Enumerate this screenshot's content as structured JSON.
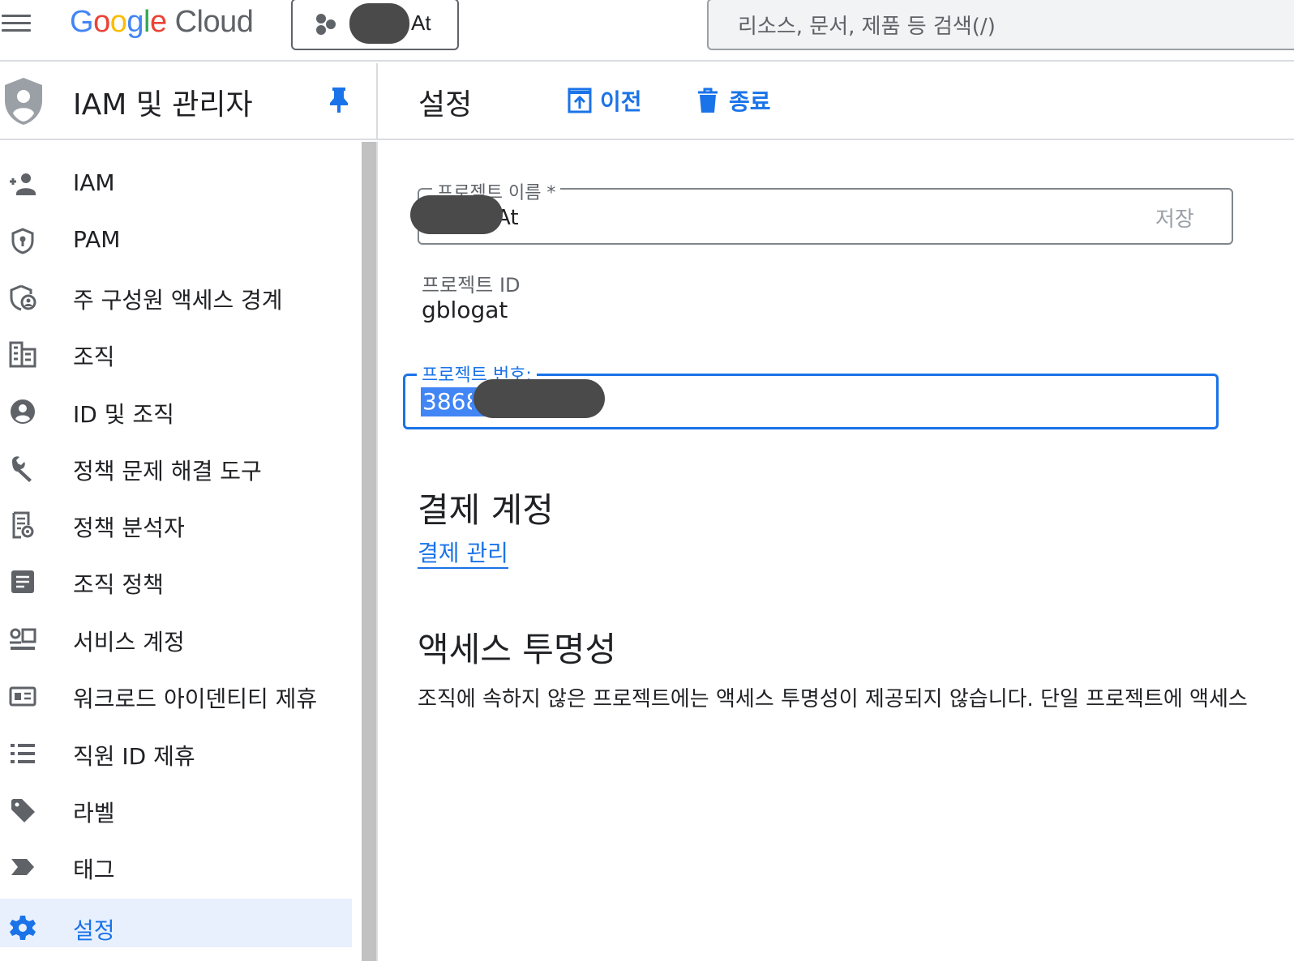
{
  "topbar": {
    "logo_google": "Google",
    "logo_cloud": "Cloud",
    "project_name": "At",
    "search_placeholder": "리소스, 문서, 제품 등 검색(/)"
  },
  "sidebar": {
    "title": "IAM 및 관리자",
    "items": [
      {
        "label": "IAM",
        "icon": "person-add-icon"
      },
      {
        "label": "PAM",
        "icon": "shield-lock-icon"
      },
      {
        "label": "주 구성원 액세스 경계",
        "icon": "shield-person-icon"
      },
      {
        "label": "조직",
        "icon": "building-icon"
      },
      {
        "label": "ID 및 조직",
        "icon": "account-circle-icon"
      },
      {
        "label": "정책 문제 해결 도구",
        "icon": "wrench-icon"
      },
      {
        "label": "정책 분석자",
        "icon": "policy-doc-icon"
      },
      {
        "label": "조직 정책",
        "icon": "article-icon"
      },
      {
        "label": "서비스 계정",
        "icon": "service-account-icon"
      },
      {
        "label": "워크로드 아이덴티티 제휴",
        "icon": "id-card-icon"
      },
      {
        "label": "직원 ID 제휴",
        "icon": "list-icon"
      },
      {
        "label": "라벨",
        "icon": "label-icon"
      },
      {
        "label": "태그",
        "icon": "tag-icon"
      },
      {
        "label": "설정",
        "icon": "gear-icon",
        "active": true
      }
    ]
  },
  "main": {
    "title": "설정",
    "migrate_label": "이전",
    "shutdown_label": "종료",
    "project_name_label": "프로젝트 이름 *",
    "project_name_value": "At",
    "save_label": "저장",
    "project_id_label": "프로젝트 ID",
    "project_id_value": "gblogat",
    "project_number_label": "프로젝트 번호:",
    "project_number_value": "3868",
    "billing_heading": "결제 계정",
    "billing_link": "결제 관리",
    "access_heading": "액세스 투명성",
    "access_text": "조직에 속하지 않은 프로젝트에는 액세스 투명성이 제공되지 않습니다. 단일 프로젝트에 액세스"
  },
  "colors": {
    "accent": "#1a73e8",
    "active_bg": "#e8f0fe",
    "text": "#202124",
    "muted": "#5f6368",
    "redaction": "#4a4a4a"
  }
}
